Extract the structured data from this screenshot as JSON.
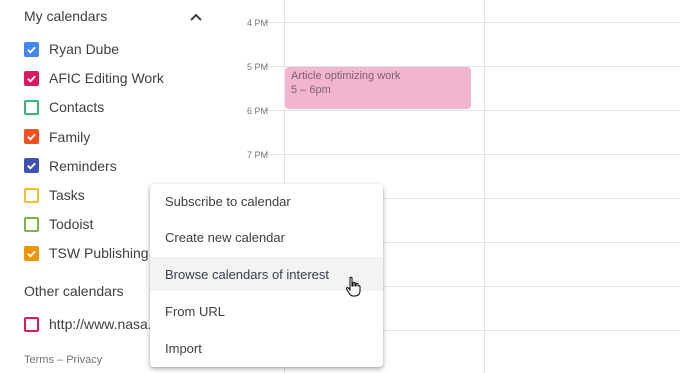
{
  "sidebar": {
    "my_calendars": {
      "title": "My calendars",
      "items": [
        {
          "label": "Ryan Dube",
          "color": "#4285f4",
          "checked": true
        },
        {
          "label": "AFIC Editing Work",
          "color": "#d81b60",
          "checked": true
        },
        {
          "label": "Contacts",
          "color": "#33b679",
          "checked": false
        },
        {
          "label": "Family",
          "color": "#f4511e",
          "checked": true
        },
        {
          "label": "Reminders",
          "color": "#3f51b5",
          "checked": true
        },
        {
          "label": "Tasks",
          "color": "#f6bf26",
          "checked": false
        },
        {
          "label": "Todoist",
          "color": "#7cb342",
          "checked": false
        },
        {
          "label": "TSW Publishing S",
          "color": "#f09300",
          "checked": true
        }
      ]
    },
    "other_calendars": {
      "title": "Other calendars",
      "items": [
        {
          "label": "http://www.nasa.g",
          "color": "#d81b60",
          "checked": false
        }
      ]
    },
    "footer": {
      "terms": "Terms",
      "separator": "–",
      "privacy": "Privacy"
    }
  },
  "grid": {
    "times": [
      "4 PM",
      "5 PM",
      "6 PM",
      "7 PM"
    ]
  },
  "event": {
    "title": "Article optimizing work",
    "time": "5 – 6pm",
    "color": "#f1b5cf"
  },
  "menu": {
    "items": [
      {
        "label": "Subscribe to calendar"
      },
      {
        "label": "Create new calendar"
      },
      {
        "label": "Browse calendars of interest",
        "hovered": true
      },
      {
        "label": "From URL"
      },
      {
        "label": "Import"
      }
    ]
  }
}
